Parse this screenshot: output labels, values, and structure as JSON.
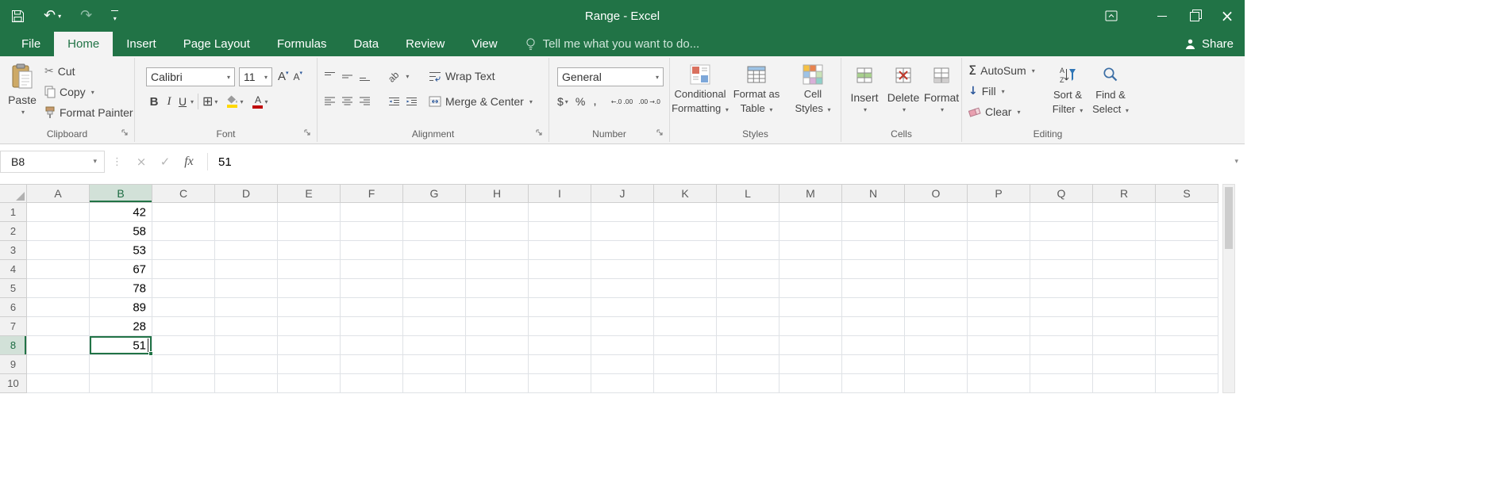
{
  "titlebar": {
    "title": "Range - Excel"
  },
  "tabbar": {
    "tabs": [
      "File",
      "Home",
      "Insert",
      "Page Layout",
      "Formulas",
      "Data",
      "Review",
      "View"
    ],
    "active_tab": "Home",
    "tell_me_text": "Tell me what you want to do...",
    "share_label": "Share"
  },
  "ribbon": {
    "clipboard": {
      "group_label": "Clipboard",
      "paste_label": "Paste",
      "cut_label": "Cut",
      "copy_label": "Copy",
      "format_painter_label": "Format Painter"
    },
    "font": {
      "group_label": "Font",
      "font_name_value": "Calibri",
      "font_size_value": "11"
    },
    "alignment": {
      "group_label": "Alignment",
      "wrap_text_label": "Wrap Text",
      "merge_center_label": "Merge & Center"
    },
    "number": {
      "group_label": "Number",
      "number_format_value": "General"
    },
    "styles": {
      "group_label": "Styles",
      "conditional_formatting_line1": "Conditional",
      "conditional_formatting_line2": "Formatting",
      "format_as_table_line1": "Format as",
      "format_as_table_line2": "Table",
      "cell_styles_line1": "Cell",
      "cell_styles_line2": "Styles"
    },
    "cells": {
      "group_label": "Cells",
      "insert_label": "Insert",
      "delete_label": "Delete",
      "format_label": "Format"
    },
    "editing": {
      "group_label": "Editing",
      "autosum_label": "AutoSum",
      "fill_label": "Fill",
      "clear_label": "Clear",
      "sort_filter_line1": "Sort &",
      "sort_filter_line2": "Filter",
      "find_select_line1": "Find &",
      "find_select_line2": "Select"
    }
  },
  "formula_bar": {
    "name_box_value": "B8",
    "formula_value": "51"
  },
  "grid": {
    "columns": [
      "A",
      "B",
      "C",
      "D",
      "E",
      "F",
      "G",
      "H",
      "I",
      "J",
      "K",
      "L",
      "M",
      "N",
      "O",
      "P",
      "Q",
      "R",
      "S"
    ],
    "rows": [
      "1",
      "2",
      "3",
      "4",
      "5",
      "6",
      "7",
      "8",
      "9",
      "10"
    ],
    "cell_values": {
      "B1": "42",
      "B2": "58",
      "B3": "53",
      "B4": "67",
      "B5": "78",
      "B6": "89",
      "B7": "28",
      "B8": "51"
    },
    "selection": {
      "cell": "B8",
      "column": "B",
      "row": "8"
    }
  },
  "icons": {
    "caret": "▾",
    "undo": "↶",
    "redo": "↷",
    "close": "×",
    "cut": "✂",
    "borders": "⊞",
    "bold": "B",
    "italic": "I",
    "underline": "U",
    "grow_font": "A",
    "shrink_font": "A",
    "font_color_letter": "A",
    "orientation_letters": "ab",
    "currency": "$",
    "percent": "%",
    "comma": ",",
    "increase_decimal": "←.0 .00",
    "decrease_decimal": ".00 →.0",
    "autosum": "Σ",
    "fill_arrow": "↓",
    "fx": "fx",
    "cancel": "×",
    "enter": "✓",
    "dots": "⋮",
    "expand": "▾"
  },
  "colors": {
    "excel_green": "#217346",
    "selection_border": "#217346",
    "fill_color_swatch": "#ffd800",
    "font_color_swatch": "#c00000",
    "ribbon_background": "#f3f3f3"
  }
}
